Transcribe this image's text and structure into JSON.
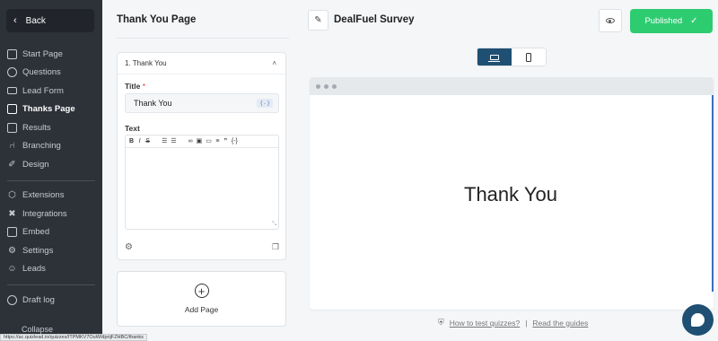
{
  "sidebar": {
    "back_label": "Back",
    "items": [
      {
        "label": "Start Page",
        "icon": "square-icon"
      },
      {
        "label": "Questions",
        "icon": "question-icon"
      },
      {
        "label": "Lead Form",
        "icon": "envelope-icon"
      },
      {
        "label": "Thanks Page",
        "icon": "thanks-page-icon",
        "active": true
      },
      {
        "label": "Results",
        "icon": "results-icon"
      },
      {
        "label": "Branching",
        "icon": "branching-icon"
      },
      {
        "label": "Design",
        "icon": "palette-icon"
      },
      {
        "label": "Extensions",
        "icon": "puzzle-icon"
      },
      {
        "label": "Integrations",
        "icon": "integrations-icon"
      },
      {
        "label": "Embed",
        "icon": "embed-icon"
      },
      {
        "label": "Settings",
        "icon": "gear-icon"
      },
      {
        "label": "Leads",
        "icon": "users-icon"
      },
      {
        "label": "Draft log",
        "icon": "clock-icon"
      }
    ],
    "collapse_label": "Collapse"
  },
  "editor": {
    "title": "Thank You Page",
    "section_label": "1. Thank You",
    "title_field_label": "Title",
    "title_value": "Thank You",
    "variable_button": "{-}",
    "text_field_label": "Text",
    "add_page_label": "Add Page"
  },
  "header": {
    "survey_name": "DealFuel Survey",
    "publish_label": "Published"
  },
  "preview": {
    "heading": "Thank You"
  },
  "help": {
    "test_link": "How to test quizzes?",
    "separator": "|",
    "guides_link": "Read the guides"
  },
  "status_bar": {
    "url": "https://ac.quizlead.io/quizzes/ITPMKV7OuW/dprijFZHBC/thanks"
  },
  "colors": {
    "sidebar_bg": "#2d3138",
    "publish_green": "#2ecc71",
    "accent_blue": "#1f4f73"
  }
}
